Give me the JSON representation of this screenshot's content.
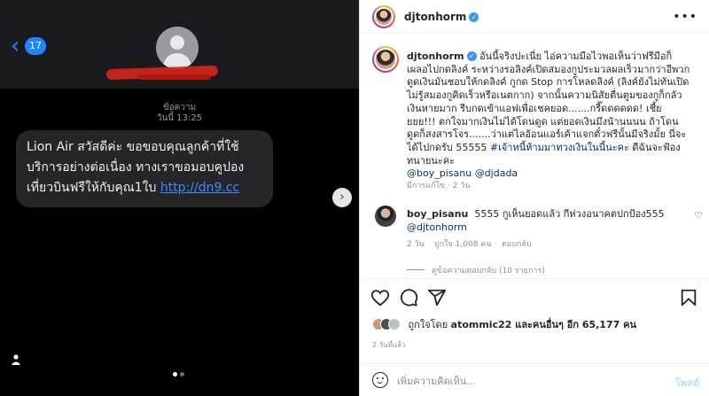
{
  "sms": {
    "badge": "17",
    "meta_line1": "ข้อความ",
    "meta_line2": "วันนี้ 13:25",
    "bubble_text": "Lion Air สวัสดีค่ะ ขอขอบคุณลูกค้าที่ใช้บริการอย่างต่อเนื่อง ทางเราขอมอบคูปองเที่ยวบินฟรีให้กับคุณ1ใบ ",
    "link": "http://dn9.cc"
  },
  "carousel": {
    "current": 1,
    "total": 2,
    "active_dot": "#ffffff",
    "inactive_dot": "#6b6b6b"
  },
  "post": {
    "author": "djtonhorm",
    "caption_author": "djtonhorm",
    "caption_text": "อันนี้จริงปะเนี่ย ไอ่ความมือไวพอเห็นว่าฟรีมือก็เผลอไปกดลิงค์ ระหว่างรอลิงค์เปิดสมองกูประมวลผลเร็วมากว่าอีพวกดูดเงินมันชอบให้กดลิงค์ กูกด Stop การโหลดลิงค์ (ลิงค์ยังไม่ทันเปิด ไม่รู้สมองกูคิดเร็วหรือเนตกาก) จากนั้นความนิสัยตื่นตูมของกูก็กลัวเงินหายมาก รีบกดเข้าแอฟเพื่อเชคยอด.......กรี๊ดดดดดด! เชี้ยยยย!!! ตกใจมากเงินไม่ได้โดนดูด แต่ยอดเงินมึงน้านนนน ถ้าโดนดูดก็สงสารโจร.......ว่าแต่ไลอ้อนแอร์เค้าแจกตั๋วฟรีนั้นมีจริงมั้ย นี่จะได้ไปกดรับ 55555",
    "hashtag": "#เจ้าหนี้ห้ามมาทวงเงินในนี้นะคะ",
    "hashtag_after": " ดีฉันจะฟ้องทนายนะคะ",
    "mention1": "@boy_pisanu",
    "mention2": "@djdada",
    "caption_meta": "มีการแก้ไข · 2 วัน",
    "more_label": "•••"
  },
  "comment": {
    "user": "boy_pisanu",
    "text": "5555 กูเห็นยอดแล้ว กีห่วงอนาคตปกป้อง555",
    "mention": "@djtonhorm",
    "age": "2 วัน",
    "likes": "ถูกใจ 1,008 คน",
    "reply": "ตอบกลับ",
    "view_replies": "ดูข้อความตอบกลับ (10 รายการ)"
  },
  "actions": {
    "liked_by_prefix": "ถูกใจโดย ",
    "liked_by_user": "atommic22",
    "liked_by_suffix": " และคนอื่นๆ อีก 65,177 คน",
    "time_ago": "2 วันที่แล้ว"
  },
  "composer": {
    "placeholder": "เพิ่มความคิดเห็น...",
    "post_label": "โพสต์"
  },
  "colors": {
    "link_blue": "#3a8cff",
    "mention_blue": "#00376b",
    "ig_blue": "#3897f0",
    "redaction_red": "#d3261b"
  },
  "icons": [
    "back-chevron-icon",
    "contact-avatar-icon",
    "next-arrow-icon",
    "person-icon",
    "verified-icon",
    "more-icon",
    "heart-icon",
    "comment-icon",
    "share-icon",
    "bookmark-icon",
    "emoji-icon"
  ]
}
